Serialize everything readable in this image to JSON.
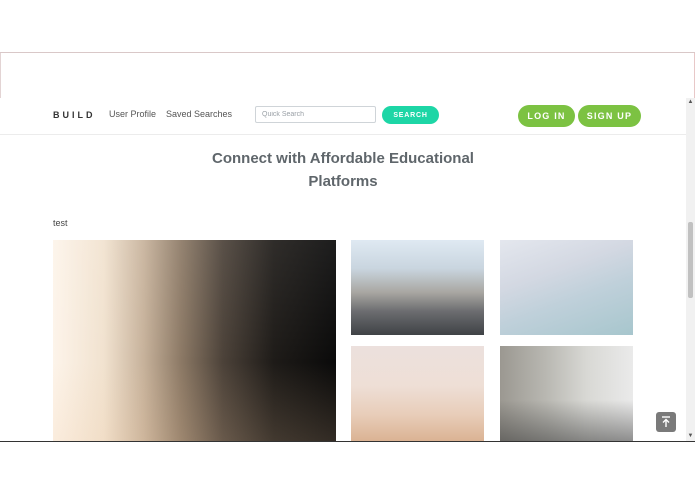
{
  "navbar": {
    "brand": "BUILD",
    "links": [
      "User Profile",
      "Saved Searches"
    ],
    "search": {
      "placeholder": "Quick Search",
      "value": ""
    },
    "search_button": "SEARCH",
    "login_button": "LOG IN",
    "signup_button": "SIGN UP"
  },
  "main": {
    "headline_line1": "Connect with Affordable Educational",
    "headline_line2": "Platforms",
    "section_label": "test"
  },
  "icons": {
    "back_to_top": "arrow-up-to-line-icon",
    "scroll_up": "triangle-up-icon",
    "scroll_down": "triangle-down-icon"
  },
  "colors": {
    "search_button": "#1dd6a6",
    "auth_buttons": "#7cc242",
    "headline": "#5f666b"
  }
}
